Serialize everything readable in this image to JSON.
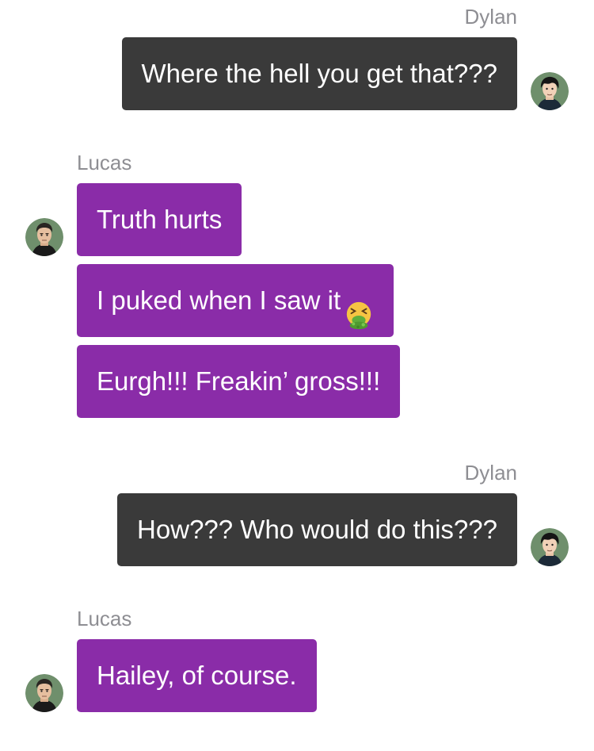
{
  "conversation": {
    "groups": [
      {
        "sender": "Dylan",
        "side": "right",
        "messages": [
          "Where the hell you get that???"
        ]
      },
      {
        "sender": "Lucas",
        "side": "left",
        "messages": [
          "Truth hurts",
          "I puked when I saw it",
          "Eurgh!!! Freakin’ gross!!!"
        ]
      },
      {
        "sender": "Dylan",
        "side": "right",
        "messages": [
          "How??? Who would do this???"
        ]
      },
      {
        "sender": "Lucas",
        "side": "left",
        "messages": [
          "Hailey, of course."
        ]
      }
    ]
  },
  "icons": {
    "dylan_avatar": "dylan-avatar-icon",
    "lucas_avatar": "lucas-avatar-icon",
    "vomit_emoji": "vomiting-face-icon"
  },
  "colors": {
    "outgoing_bubble": "#3a3a3a",
    "incoming_bubble": "#8a2ca8",
    "sender_name": "#8e8e93"
  }
}
